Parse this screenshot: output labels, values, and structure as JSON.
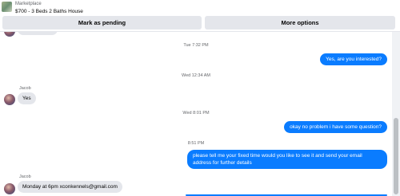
{
  "header": {
    "marketplace_label": "Marketplace",
    "listing_title": "$700 - 3 Beds 2 Baths House",
    "mark_pending_label": "Mark as pending",
    "more_options_label": "More options"
  },
  "thread": {
    "timestamps": [
      "Tue 7:32 PM",
      "Wed 12:34 AM",
      "Wed 8:01 PM",
      "8:51 PM"
    ],
    "messages": [
      {
        "from": "me",
        "text": "Yes, are you interested?"
      },
      {
        "from": "Jacob",
        "text": "Yes"
      },
      {
        "from": "me",
        "text": "okay no problem i have some question?"
      },
      {
        "from": "me",
        "text": "please tell me your fixed time would you like to see it and send your email address for further details"
      },
      {
        "from": "Jacob",
        "text": "Monday at 6pm xconkennels@gmail.com"
      }
    ],
    "sender_names": [
      "Jacob",
      "Jacob"
    ]
  },
  "colors": {
    "outgoing_bubble": "#0a7cff",
    "incoming_bubble": "#e4e6eb",
    "button_bg": "#e4e6eb"
  }
}
